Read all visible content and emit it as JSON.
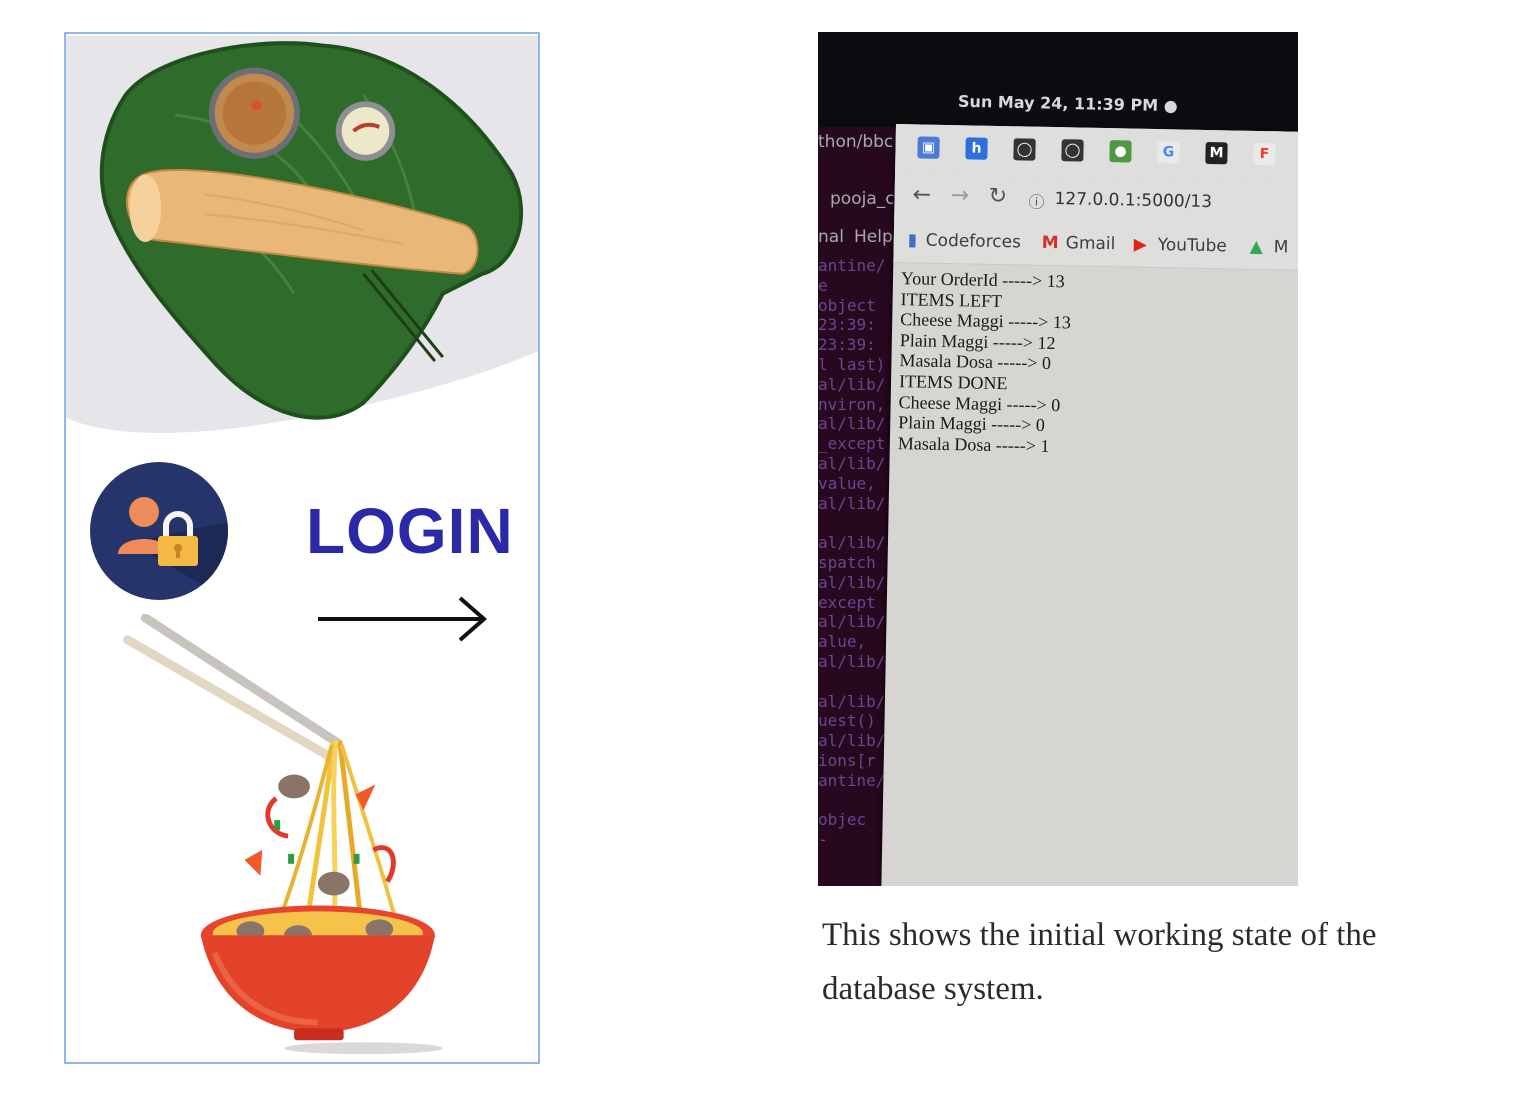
{
  "login_card": {
    "login_label": "LOGIN",
    "icons": [
      "dosa-on-banana-leaf-illustration",
      "user-lock-icon",
      "right-arrow-icon",
      "noodle-bowl-illustration"
    ]
  },
  "screenshot_photo": {
    "system_clock": "Sun May 24, 11:39 PM ●",
    "terminal_path": "thon/bbc",
    "side_window_title": "pooja_c",
    "side_menu": [
      "nal",
      "Help"
    ],
    "terminal_lines": [
      "antine/",
      "e",
      "object",
      " 23:39:",
      " 23:39:",
      "l last)",
      "al/lib/",
      "nviron,",
      "al/lib/",
      "_except",
      "al/lib/",
      "value,",
      "al/lib/",
      "",
      "al/lib/",
      "spatch",
      "al/lib/",
      "except",
      "al/lib/",
      "alue,",
      "al/lib/",
      "",
      "al/lib/",
      "uest()",
      "al/lib/",
      "ions[r",
      "antine/",
      "",
      "objec",
      "-"
    ],
    "browser": {
      "url": "127.0.0.1:5000/13",
      "bookmarks": [
        "Codeforces",
        "Gmail",
        "YouTube",
        "M"
      ],
      "content_lines": [
        "Your OrderId -----> 13",
        "ITEMS LEFT",
        "Cheese Maggi -----> 13",
        "Plain Maggi -----> 12",
        "Masala Dosa -----> 0",
        "ITEMS DONE",
        "Cheese Maggi -----> 0",
        "Plain Maggi -----> 0",
        "Masala Dosa -----> 1"
      ]
    }
  },
  "caption": "This shows the initial working state of the database system.",
  "colors": {
    "card_border": "#8fb8ee",
    "login_text": "#2a2aa6",
    "avatar_bg": "#25346a",
    "caption_text": "#2b2b2b"
  }
}
